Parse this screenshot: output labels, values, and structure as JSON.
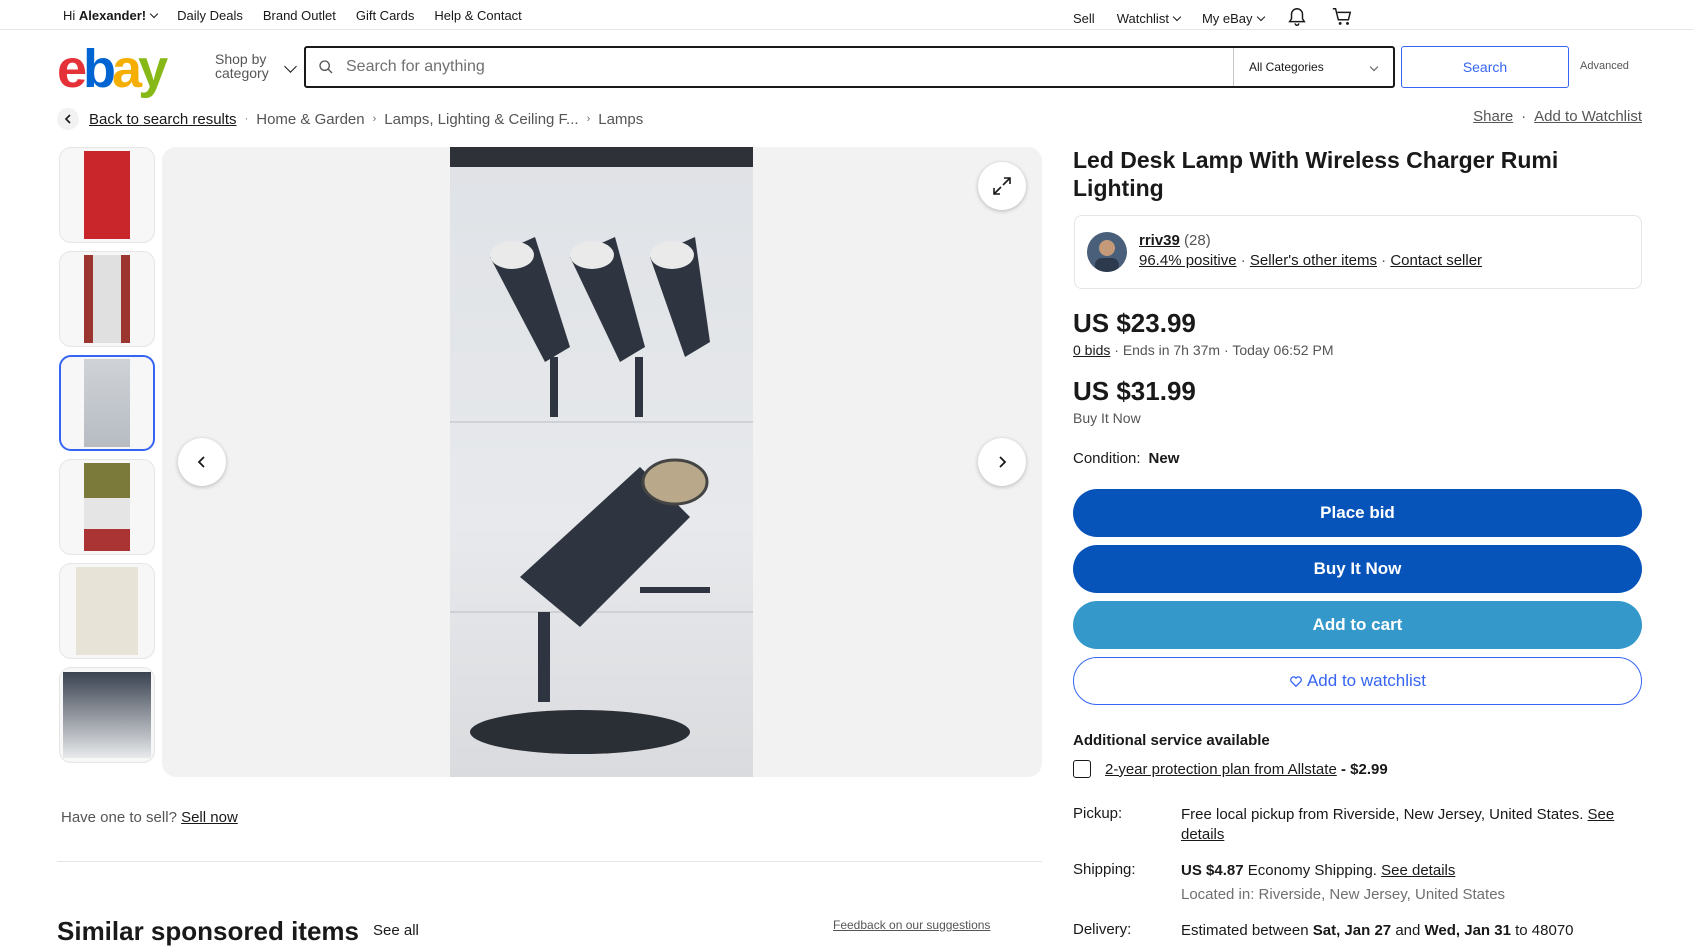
{
  "topbar": {
    "greeting_prefix": "Hi ",
    "greeting_name": "Alexander!",
    "links": [
      "Daily Deals",
      "Brand Outlet",
      "Gift Cards",
      "Help & Contact"
    ],
    "sell": "Sell",
    "watchlist": "Watchlist",
    "myebay": "My eBay"
  },
  "header": {
    "logo": [
      "e",
      "b",
      "a",
      "y"
    ],
    "shop_by_line1": "Shop by",
    "shop_by_line2": "category",
    "search_placeholder": "Search for anything",
    "category": "All Categories",
    "search_button": "Search",
    "advanced": "Advanced"
  },
  "breadcrumb": {
    "back": "Back to search results",
    "items": [
      "Home & Garden",
      "Lamps, Lighting & Ceiling F...",
      "Lamps"
    ],
    "share": "Share",
    "add_watchlist": "Add to Watchlist"
  },
  "gallery": {
    "sell_prefix": "Have one to sell?",
    "sell_link": "Sell now"
  },
  "similar": {
    "title": "Similar sponsored items",
    "see_all": "See all",
    "feedback": "Feedback on our suggestions"
  },
  "listing": {
    "title": "Led Desk Lamp With Wireless Charger Rumi Lighting",
    "seller_name": "rriv39",
    "seller_count": "(28)",
    "positive": "96.4% positive",
    "other_items": "Seller's other items",
    "contact": "Contact seller",
    "bid_price": "US $23.99",
    "bids": "0 bids",
    "ends": "Ends in 7h 37m",
    "end_time": "Today 06:52 PM",
    "bin_price": "US $31.99",
    "bin_label": "Buy It Now",
    "condition_label": "Condition:",
    "condition_value": "New",
    "place_bid": "Place bid",
    "buy_now": "Buy It Now",
    "add_cart": "Add to cart",
    "add_watchlist": "Add to watchlist",
    "additional": "Additional service available",
    "protection": "2-year protection plan from Allstate",
    "protection_price": "- $2.99",
    "pickup_label": "Pickup:",
    "pickup_text": "Free local pickup from Riverside, New Jersey, United States.",
    "see_details": "See details",
    "shipping_label": "Shipping:",
    "shipping_price": "US $4.87",
    "shipping_type": "Economy Shipping.",
    "located": "Located in: Riverside, New Jersey, United States",
    "delivery_label": "Delivery:",
    "delivery_prefix": "Estimated between",
    "delivery_start": "Sat, Jan 27",
    "delivery_and": "and",
    "delivery_end": "Wed, Jan 31",
    "delivery_to": "to 48070"
  },
  "colors": {
    "primary_button": "#0654ba",
    "cart_button": "#3498ca",
    "link_blue": "#3665f3"
  }
}
